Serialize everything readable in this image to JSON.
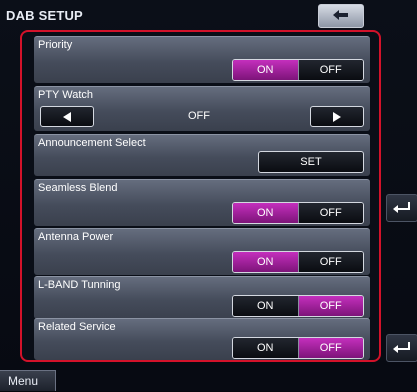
{
  "header": {
    "title": "DAB SETUP",
    "faded_text": "",
    "back_icon": "back-arrow-icon"
  },
  "settings": {
    "priority": {
      "label": "Priority",
      "on": "ON",
      "off": "OFF",
      "selected": "ON"
    },
    "pty_watch": {
      "label": "PTY Watch",
      "value": "OFF",
      "left_icon": "triangle-left-icon",
      "right_icon": "triangle-right-icon"
    },
    "announcement": {
      "label": "Announcement Select",
      "button": "SET"
    },
    "seamless_blend": {
      "label": "Seamless Blend",
      "on": "ON",
      "off": "OFF",
      "selected": "ON"
    },
    "antenna_power": {
      "label": "Antenna Power",
      "on": "ON",
      "off": "OFF",
      "selected": "ON"
    },
    "l_band": {
      "label": "L-BAND Tunning",
      "on": "ON",
      "off": "OFF",
      "selected": "OFF"
    },
    "related_service": {
      "label": "Related Service",
      "on": "ON",
      "off": "OFF",
      "selected": "OFF"
    }
  },
  "footer": {
    "menu": "Menu"
  },
  "colors": {
    "selected": "#a421a0",
    "highlight_border": "#d3122a",
    "row_bg": "#4f5666"
  }
}
